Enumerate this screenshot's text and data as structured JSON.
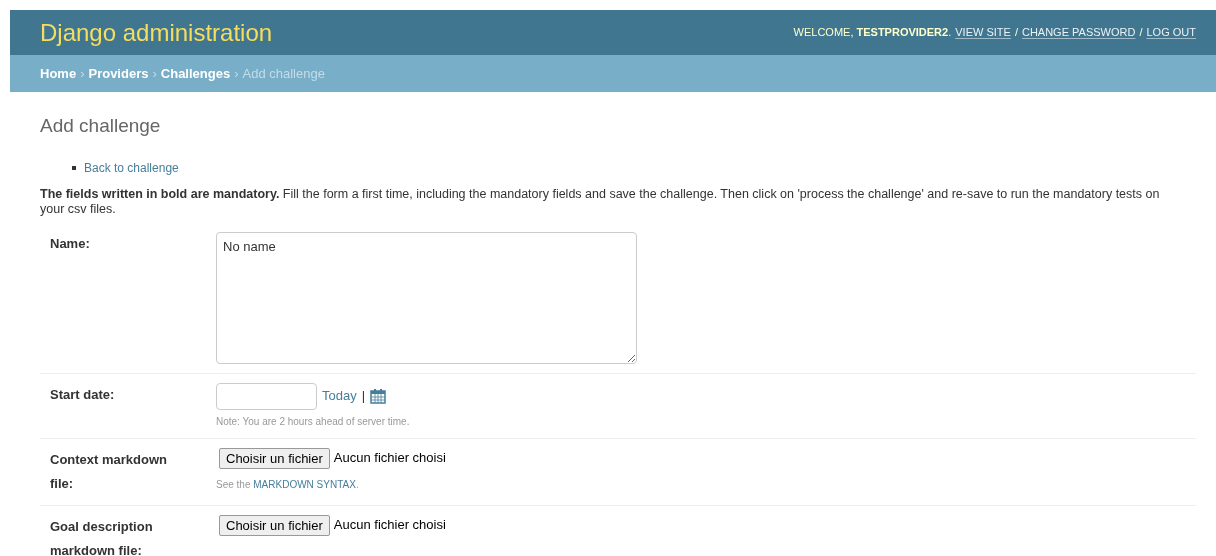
{
  "header": {
    "title": "Django administration",
    "welcome": "WELCOME, **TESTPROVIDER2**.",
    "links": [
      "VIEW SITE",
      "CHANGE PASSWORD",
      "LOG OUT"
    ],
    "separator": "/"
  },
  "breadcrumbs": {
    "separator": "›",
    "items": [
      {
        "label": "Home",
        "current": false
      },
      {
        "label": "Providers",
        "current": false
      },
      {
        "label": "Challenges",
        "current": false
      },
      {
        "label": "Add challenge",
        "current": true
      }
    ]
  },
  "page_title": "Add challenge",
  "object_tools": [
    "Back to challenge"
  ],
  "intro": "**The fields written in bold are mandatory.** Fill the form a first time, including the mandatory fields and save the challenge. Then click on 'process the challenge' and re-save to run the mandatory tests on your csv files.",
  "fields": [
    {
      "kind": "textarea",
      "label": "Name:",
      "value": "No name"
    },
    {
      "kind": "date",
      "label": "Start date:",
      "today": "Today",
      "divider": "|",
      "help": "Note: You are 2 hours ahead of server time."
    },
    {
      "kind": "file",
      "label": "Context markdown file:",
      "button": "Choisir un fichier",
      "status": "Aucun fichier choisi",
      "help_before": "See the",
      "help_link": "MARKDOWN SYNTAX",
      "help_after": "."
    },
    {
      "kind": "file",
      "label": "Goal description markdown file:",
      "button": "Choisir un fichier",
      "status": "Aucun fichier choisi"
    }
  ]
}
